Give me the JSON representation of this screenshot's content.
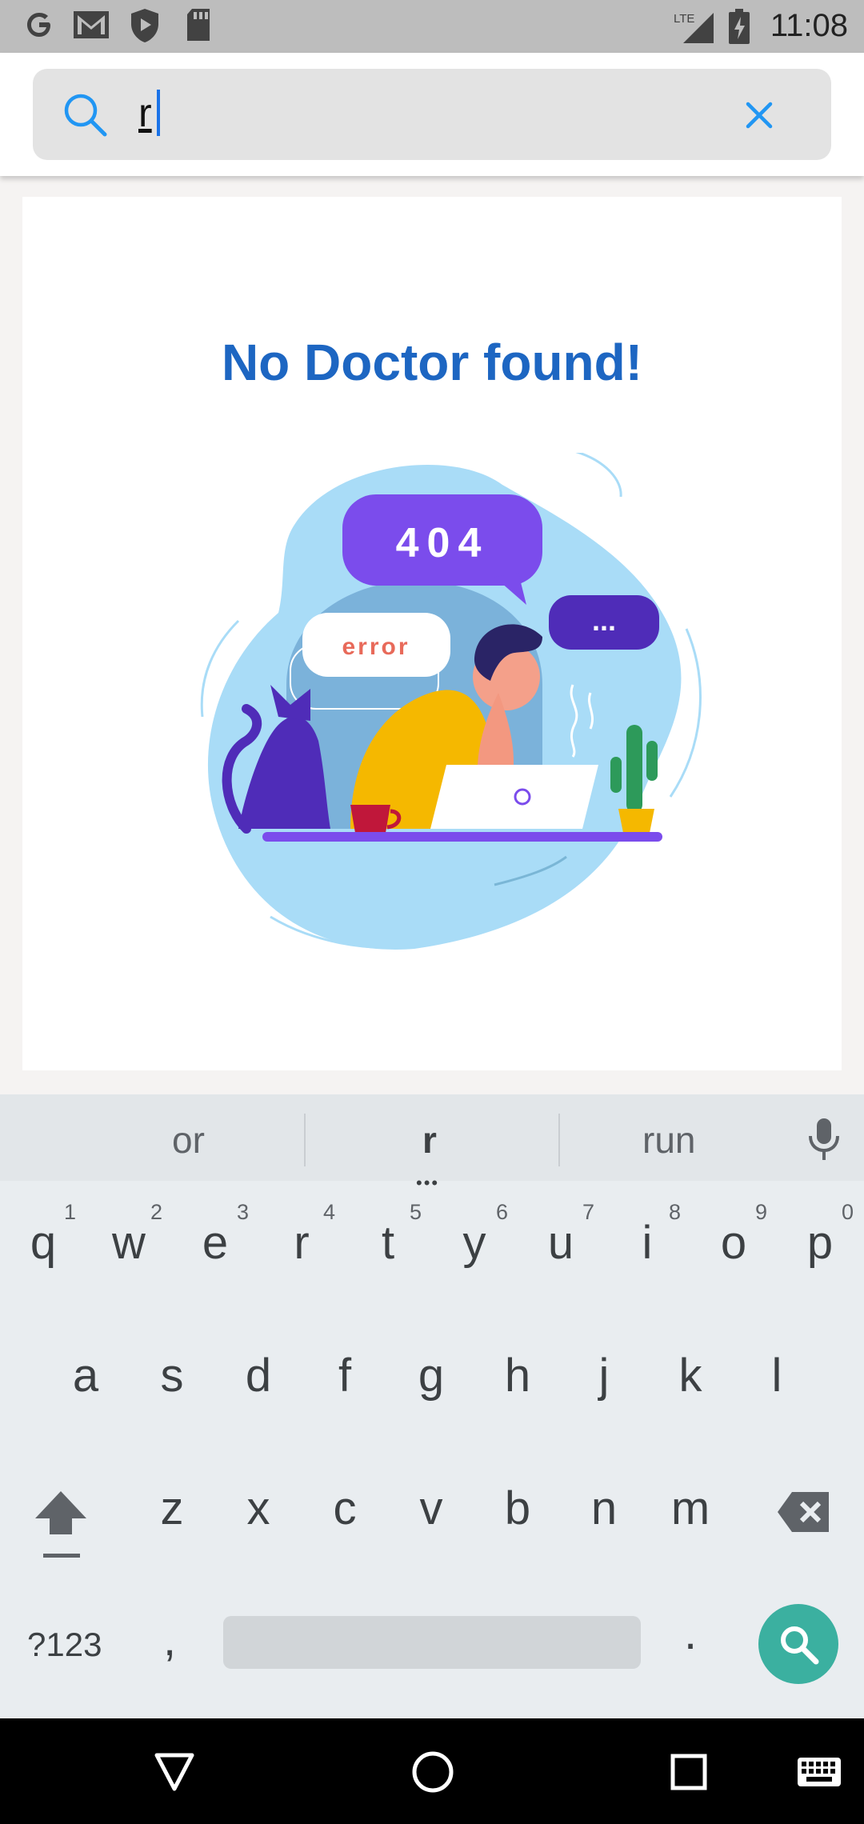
{
  "status_bar": {
    "time": "11:08",
    "network": "LTE",
    "left_icons": [
      "google-icon",
      "gmail-icon",
      "shield-icon",
      "sd-card-icon"
    ],
    "right_icons": [
      "signal-icon",
      "battery-charging-icon"
    ]
  },
  "search": {
    "value": "r",
    "icons": [
      "search-icon",
      "clear-icon"
    ]
  },
  "empty_state": {
    "title": "No Doctor found!",
    "illustration": {
      "bubble_main": "404",
      "bubble_left": "error",
      "bubble_right": "..."
    }
  },
  "keyboard": {
    "suggestions": [
      "or",
      "r",
      "run"
    ],
    "row1": [
      {
        "key": "q",
        "hint": "1"
      },
      {
        "key": "w",
        "hint": "2"
      },
      {
        "key": "e",
        "hint": "3"
      },
      {
        "key": "r",
        "hint": "4"
      },
      {
        "key": "t",
        "hint": "5"
      },
      {
        "key": "y",
        "hint": "6"
      },
      {
        "key": "u",
        "hint": "7"
      },
      {
        "key": "i",
        "hint": "8"
      },
      {
        "key": "o",
        "hint": "9"
      },
      {
        "key": "p",
        "hint": "0"
      }
    ],
    "row2": [
      "a",
      "s",
      "d",
      "f",
      "g",
      "h",
      "j",
      "k",
      "l"
    ],
    "row3": [
      "z",
      "x",
      "c",
      "v",
      "b",
      "n",
      "m"
    ],
    "row4": {
      "symbols": "?123",
      "comma": ",",
      "period": "."
    },
    "icons": [
      "mic-icon",
      "shift-icon",
      "backspace-icon",
      "search-icon"
    ]
  },
  "nav_bar": {
    "icons": [
      "back-icon",
      "home-icon",
      "recents-icon",
      "keyboard-icon"
    ]
  },
  "colors": {
    "accent": "#1d66c2",
    "search_button": "#3bb0a0",
    "illustration_purple": "#7b4cec"
  }
}
